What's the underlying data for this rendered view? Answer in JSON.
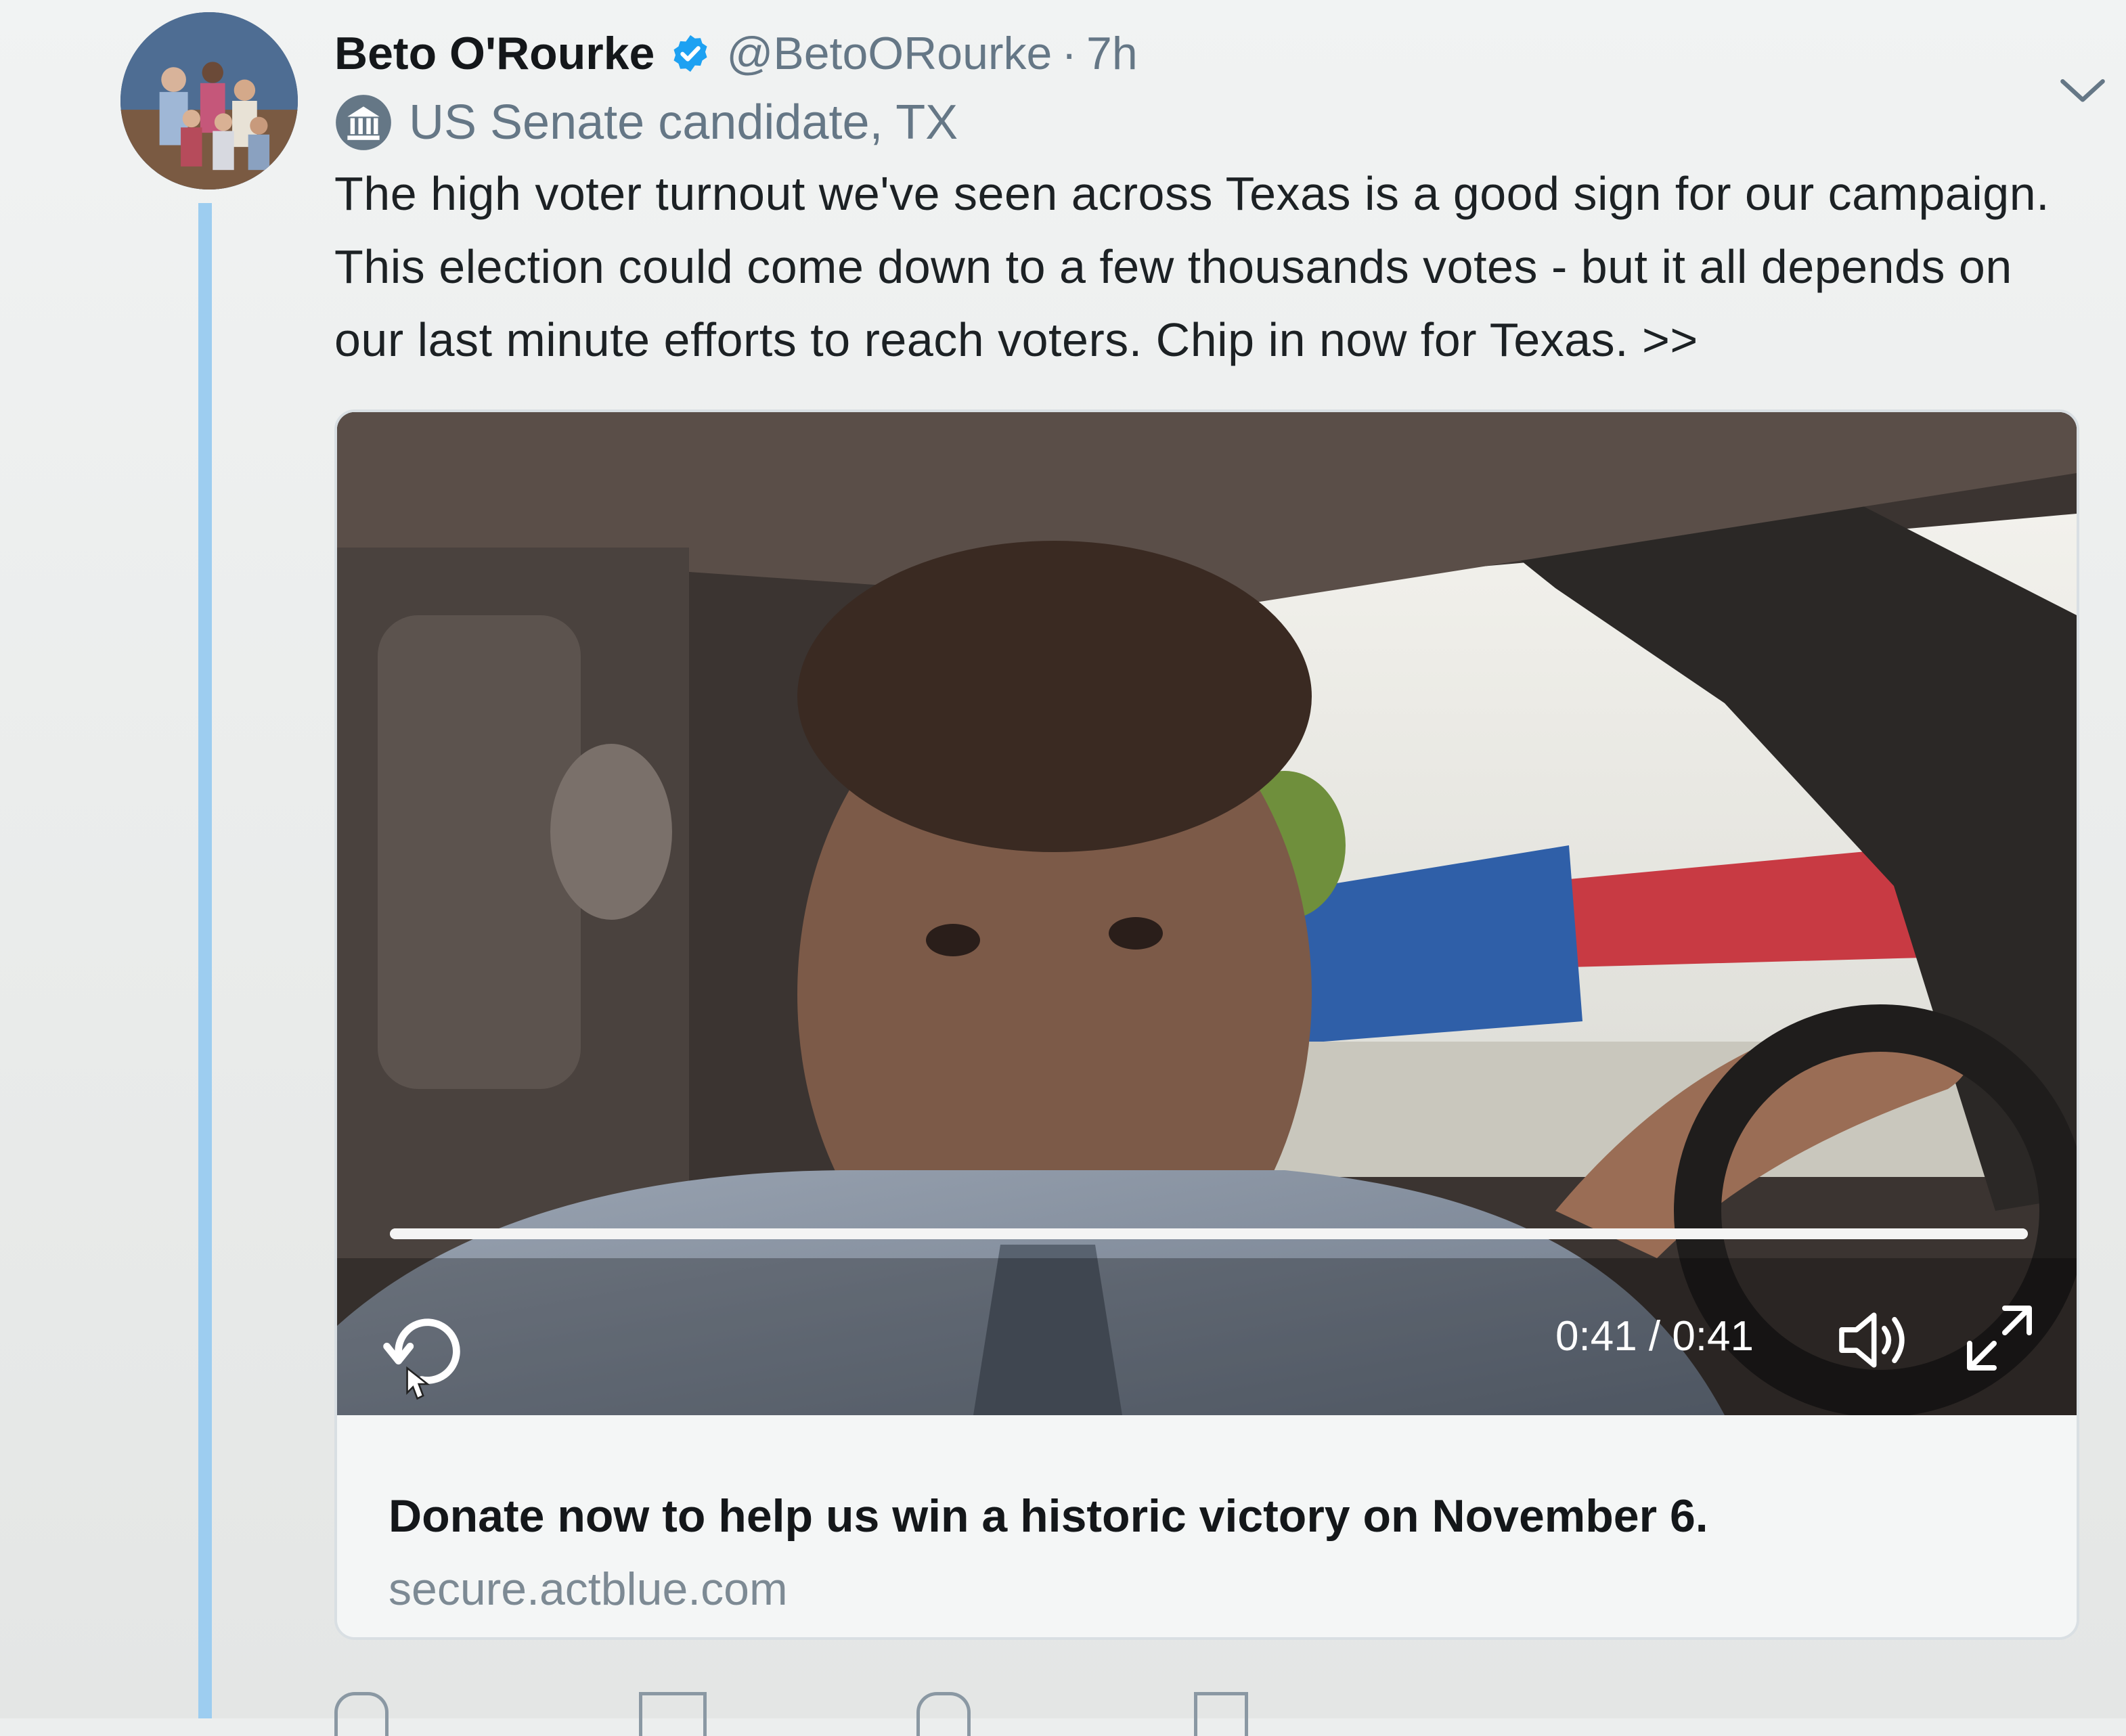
{
  "tweet": {
    "author_name": "Beto O'Rourke",
    "handle": "@BetoORourke",
    "separator": "·",
    "time": "7h",
    "label": "US Senate candidate, TX",
    "text": "The high voter turnout we've seen across Texas is a good sign for our campaign. This election could come down to a few thousands votes - but it all depends on our last minute efforts to reach voters. Chip in now for Texas. >>"
  },
  "video": {
    "time_readout": "0:41 / 0:41",
    "progress": 1.0
  },
  "card": {
    "title": "Donate now to help us win a historic victory on November 6.",
    "domain": "secure.actblue.com"
  },
  "colors": {
    "verified": "#1da1f2",
    "thread_line": "#9dcdf0",
    "secondary_text": "#657786"
  },
  "icons": {
    "verified": "verified-badge-icon",
    "label": "government-building-icon",
    "more": "chevron-down-icon",
    "replay": "replay-icon",
    "volume": "volume-icon",
    "fullscreen": "fullscreen-icon"
  }
}
